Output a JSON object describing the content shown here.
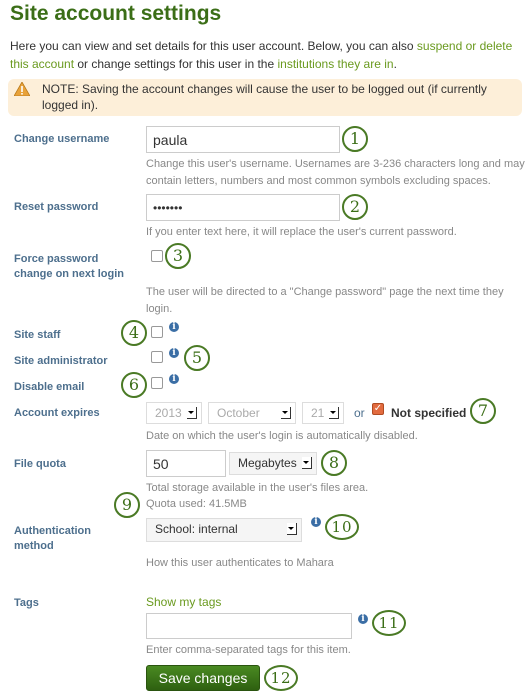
{
  "page": {
    "title": "Site account settings",
    "intro_before": "Here you can view and set details for this user account. Below, you can also ",
    "intro_link1": "suspend or delete this account",
    "intro_middle": " or change settings for this user in the ",
    "intro_link2": "institutions they are in",
    "intro_after": ".",
    "note": "NOTE: Saving the account changes will cause the user to be logged out (if currently logged in)."
  },
  "form": {
    "username": {
      "label": "Change username",
      "value": "paula",
      "description": "Change this user's username. Usernames are 3-236 characters long and may contain letters, numbers and most common symbols excluding spaces."
    },
    "password": {
      "label": "Reset password",
      "value": "•••••••",
      "description": "If you enter text here, it will replace the user's current password."
    },
    "force_password": {
      "label": "Force password change on next login",
      "checked": false,
      "description": "The user will be directed to a \"Change password\" page the next time they login."
    },
    "site_staff": {
      "label": "Site staff",
      "checked": false
    },
    "site_admin": {
      "label": "Site administrator",
      "checked": false
    },
    "disable_email": {
      "label": "Disable email",
      "checked": false
    },
    "account_expires": {
      "label": "Account expires",
      "year": "2013",
      "month": "October",
      "day": "21",
      "or_text": "or",
      "not_specified_label": "Not specified",
      "not_specified_checked": true,
      "description": "Date on which the user's login is automatically disabled."
    },
    "file_quota": {
      "label": "File quota",
      "value": "50",
      "unit": "Megabytes",
      "description": "Total storage available in the user's files area.",
      "quota_used": "Quota used: 41.5MB"
    },
    "auth_method": {
      "label": "Authentication method",
      "value": "School: internal",
      "description": "How this user authenticates to Mahara"
    },
    "tags": {
      "label": "Tags",
      "show_link": "Show my tags",
      "value": "",
      "description": "Enter comma-separated tags for this item."
    },
    "save_label": "Save changes"
  },
  "callouts": [
    "1",
    "2",
    "3",
    "4",
    "5",
    "6",
    "7",
    "8",
    "9",
    "10",
    "11",
    "12"
  ],
  "colors": {
    "title": "#3b6e17",
    "link": "#6a9a1f",
    "label": "#4d6f8d",
    "note_bg": "#fdefd9",
    "save_button": "#3b7a18"
  }
}
